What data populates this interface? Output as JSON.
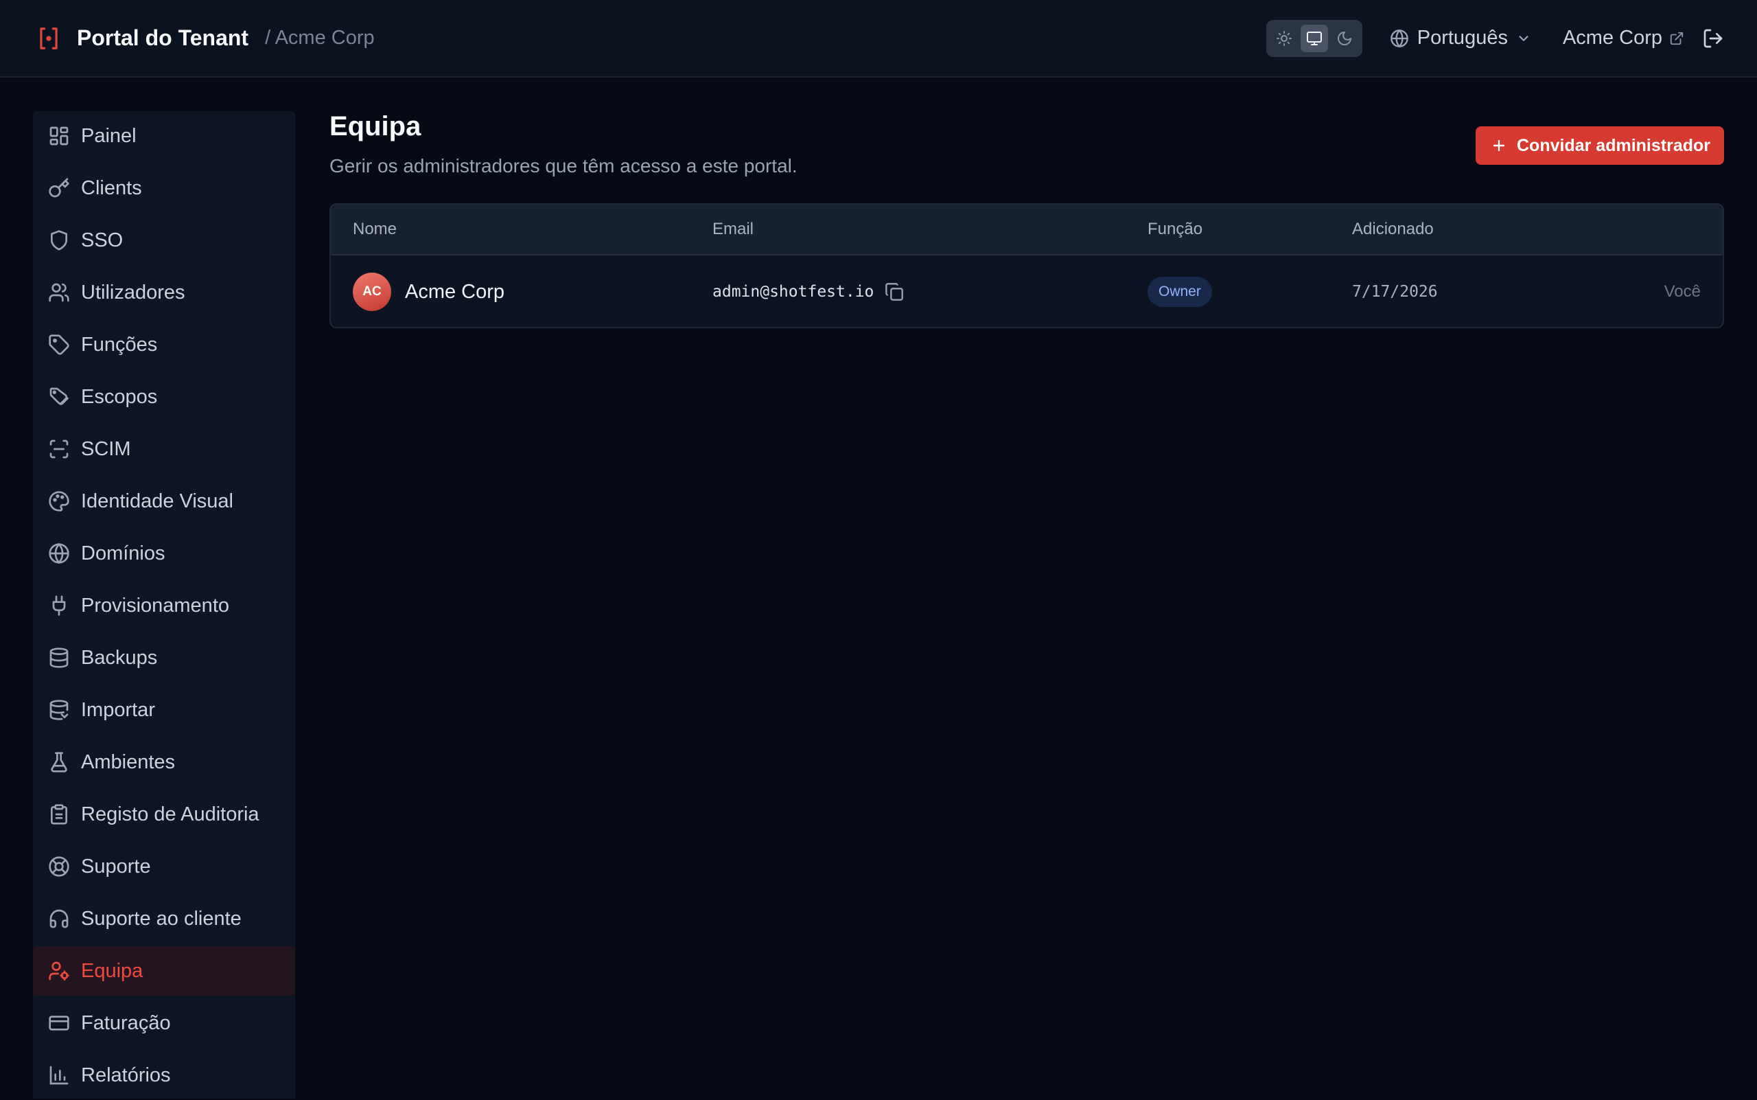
{
  "header": {
    "brand_title": "Portal do Tenant",
    "breadcrumb": "/ Acme Corp",
    "theme_options": [
      "sun-icon",
      "monitor-icon",
      "moon-icon"
    ],
    "theme_selected": "monitor-icon",
    "language": "Português",
    "tenant_link": "Acme Corp"
  },
  "sidebar": {
    "items": [
      {
        "label": "Painel",
        "icon": "dashboard-icon"
      },
      {
        "label": "Clients",
        "icon": "key-icon"
      },
      {
        "label": "SSO",
        "icon": "shield-icon"
      },
      {
        "label": "Utilizadores",
        "icon": "users-icon"
      },
      {
        "label": "Funções",
        "icon": "tag-icon"
      },
      {
        "label": "Escopos",
        "icon": "tags-icon"
      },
      {
        "label": "SCIM",
        "icon": "scan-icon"
      },
      {
        "label": "Identidade Visual",
        "icon": "palette-icon"
      },
      {
        "label": "Domínios",
        "icon": "globe-icon"
      },
      {
        "label": "Provisionamento",
        "icon": "plug-icon"
      },
      {
        "label": "Backups",
        "icon": "database-icon"
      },
      {
        "label": "Importar",
        "icon": "database-import-icon"
      },
      {
        "label": "Ambientes",
        "icon": "flask-icon"
      },
      {
        "label": "Registo de Auditoria",
        "icon": "clipboard-icon"
      },
      {
        "label": "Suporte",
        "icon": "life-buoy-icon"
      },
      {
        "label": "Suporte ao cliente",
        "icon": "headset-icon"
      },
      {
        "label": "Equipa",
        "icon": "user-cog-icon"
      },
      {
        "label": "Faturação",
        "icon": "credit-card-icon"
      },
      {
        "label": "Relatórios",
        "icon": "bar-chart-icon"
      }
    ],
    "active": "Equipa"
  },
  "main": {
    "title": "Equipa",
    "subtitle": "Gerir os administradores que têm acesso a este portal.",
    "invite_label": "Convidar administrador",
    "table": {
      "columns": [
        "Nome",
        "Email",
        "Função",
        "Adicionado"
      ],
      "rows": [
        {
          "initials": "AC",
          "name": "Acme Corp",
          "email": "admin@shotfest.io",
          "role": "Owner",
          "added": "7/17/2026",
          "note": "Você"
        }
      ]
    }
  },
  "colors": {
    "accent": "#d63a31",
    "active_nav": "#ef4a3e",
    "badge_bg": "#18284a",
    "badge_text": "#93b4f5"
  }
}
